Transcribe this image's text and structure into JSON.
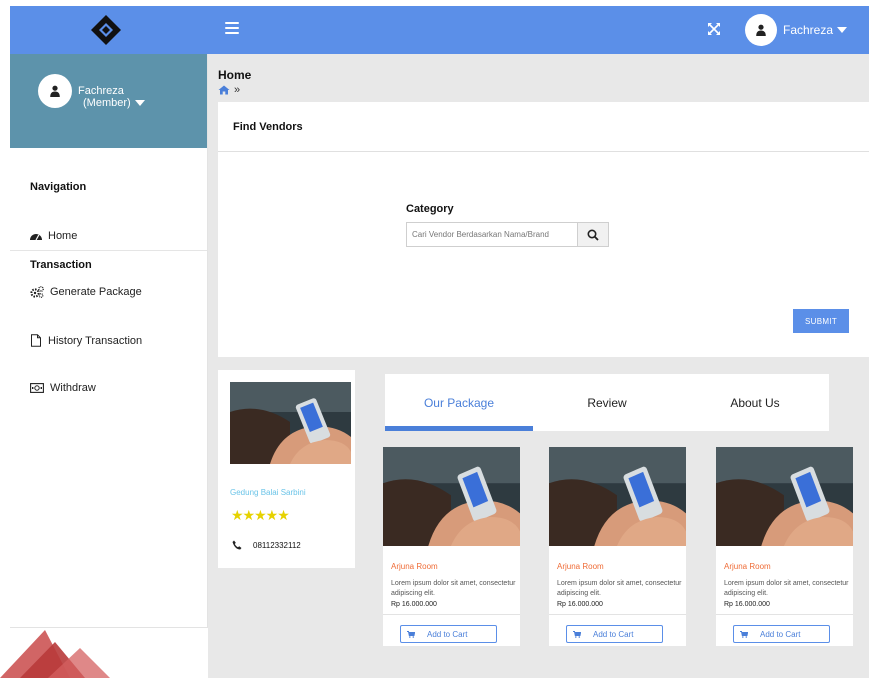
{
  "topbar": {
    "user_name": "Fachreza",
    "color": "#5b8fe8"
  },
  "sidebar": {
    "user_name": "Fachreza",
    "user_role": "(Member)",
    "navigation_heading": "Navigation",
    "transaction_heading": "Transaction",
    "items": [
      {
        "label": "Home",
        "icon": "dashboard-icon"
      },
      {
        "label": "Generate Package",
        "icon": "gears-icon"
      },
      {
        "label": "History Transaction",
        "icon": "file-icon"
      },
      {
        "label": "Withdraw",
        "icon": "money-icon"
      }
    ]
  },
  "main": {
    "page_title": "Home",
    "breadcrumb_separator": "»",
    "find_vendors": {
      "title": "Find Vendors",
      "category_label": "Category",
      "search_placeholder": "Cari Vendor Berdasarkan Nama/Brand",
      "submit_label": "SUBMIT"
    },
    "vendor": {
      "name": "Gedung Balai Sarbini",
      "rating": 5,
      "stars": "★★★★★",
      "phone": "08112332112"
    },
    "tabs": [
      {
        "label": "Our Package",
        "active": true
      },
      {
        "label": "Review",
        "active": false
      },
      {
        "label": "About Us",
        "active": false
      }
    ],
    "packages": [
      {
        "name": "Arjuna Room",
        "description": "Lorem ipsum dolor sit amet, consectetur adipiscing elit.",
        "price": "Rp 16.000.000",
        "cart_label": "Add to Cart"
      },
      {
        "name": "Arjuna Room",
        "description": "Lorem ipsum dolor sit amet, consectetur adipiscing elit.",
        "price": "Rp 16.000.000",
        "cart_label": "Add to Cart"
      },
      {
        "name": "Arjuna Room",
        "description": "Lorem ipsum dolor sit amet, consectetur adipiscing elit.",
        "price": "Rp 16.000.000",
        "cart_label": "Add to Cart"
      }
    ]
  },
  "colors": {
    "accent": "#5b8fe8",
    "sidebar_profile": "#5d93ab",
    "package_name": "#ef6c37",
    "vendor_name": "#6bc4e8",
    "star": "#e6d200"
  }
}
